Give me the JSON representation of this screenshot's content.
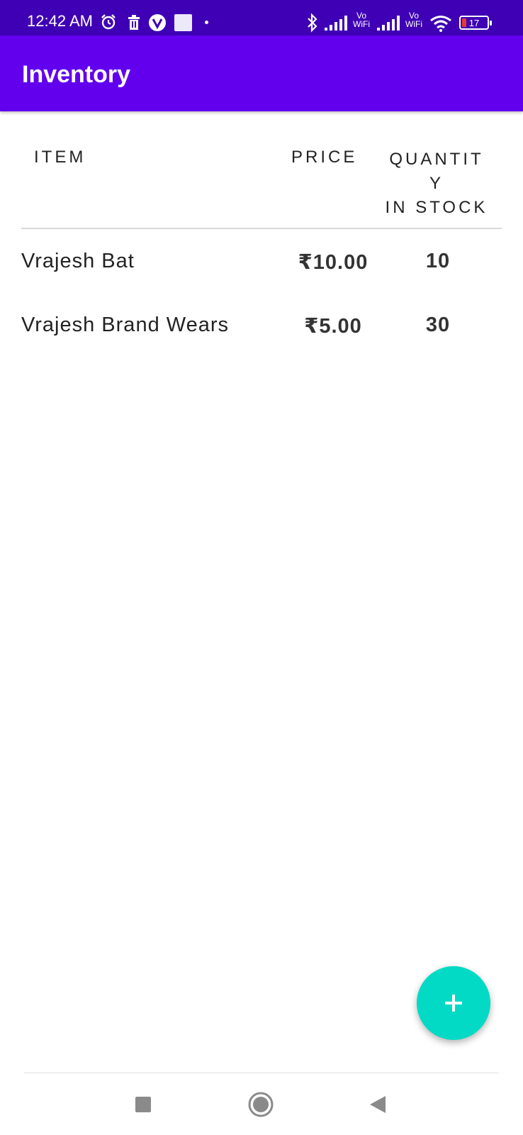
{
  "status_bar": {
    "time": "12:42 AM",
    "icons": [
      "alarm-icon",
      "trash-icon",
      "vpn-icon",
      "notification-square-icon",
      "dot-icon",
      "bluetooth-icon",
      "signal-1-icon",
      "vowifi-1",
      "signal-2-icon",
      "vowifi-2",
      "wifi-icon",
      "battery-icon"
    ],
    "vowifi_top": "Vo",
    "vowifi_bottom": "WiFi",
    "battery_level": "17"
  },
  "app_bar": {
    "title": "Inventory",
    "color": "#6200ee"
  },
  "table": {
    "headers": {
      "item": "ITEM",
      "price": "PRICE",
      "quantity_line1": "QUANTIT",
      "quantity_line2": "Y",
      "quantity_line3": "IN STOCK"
    },
    "rows": [
      {
        "item": "Vrajesh Bat",
        "price": "₹10.00",
        "quantity": "10"
      },
      {
        "item": "Vrajesh Brand Wears",
        "price": "₹5.00",
        "quantity": "30"
      }
    ]
  },
  "fab": {
    "icon": "plus-icon",
    "color": "#03dac5"
  },
  "nav_bar": {
    "icons": [
      "recent-apps-icon",
      "home-icon",
      "back-icon"
    ]
  }
}
